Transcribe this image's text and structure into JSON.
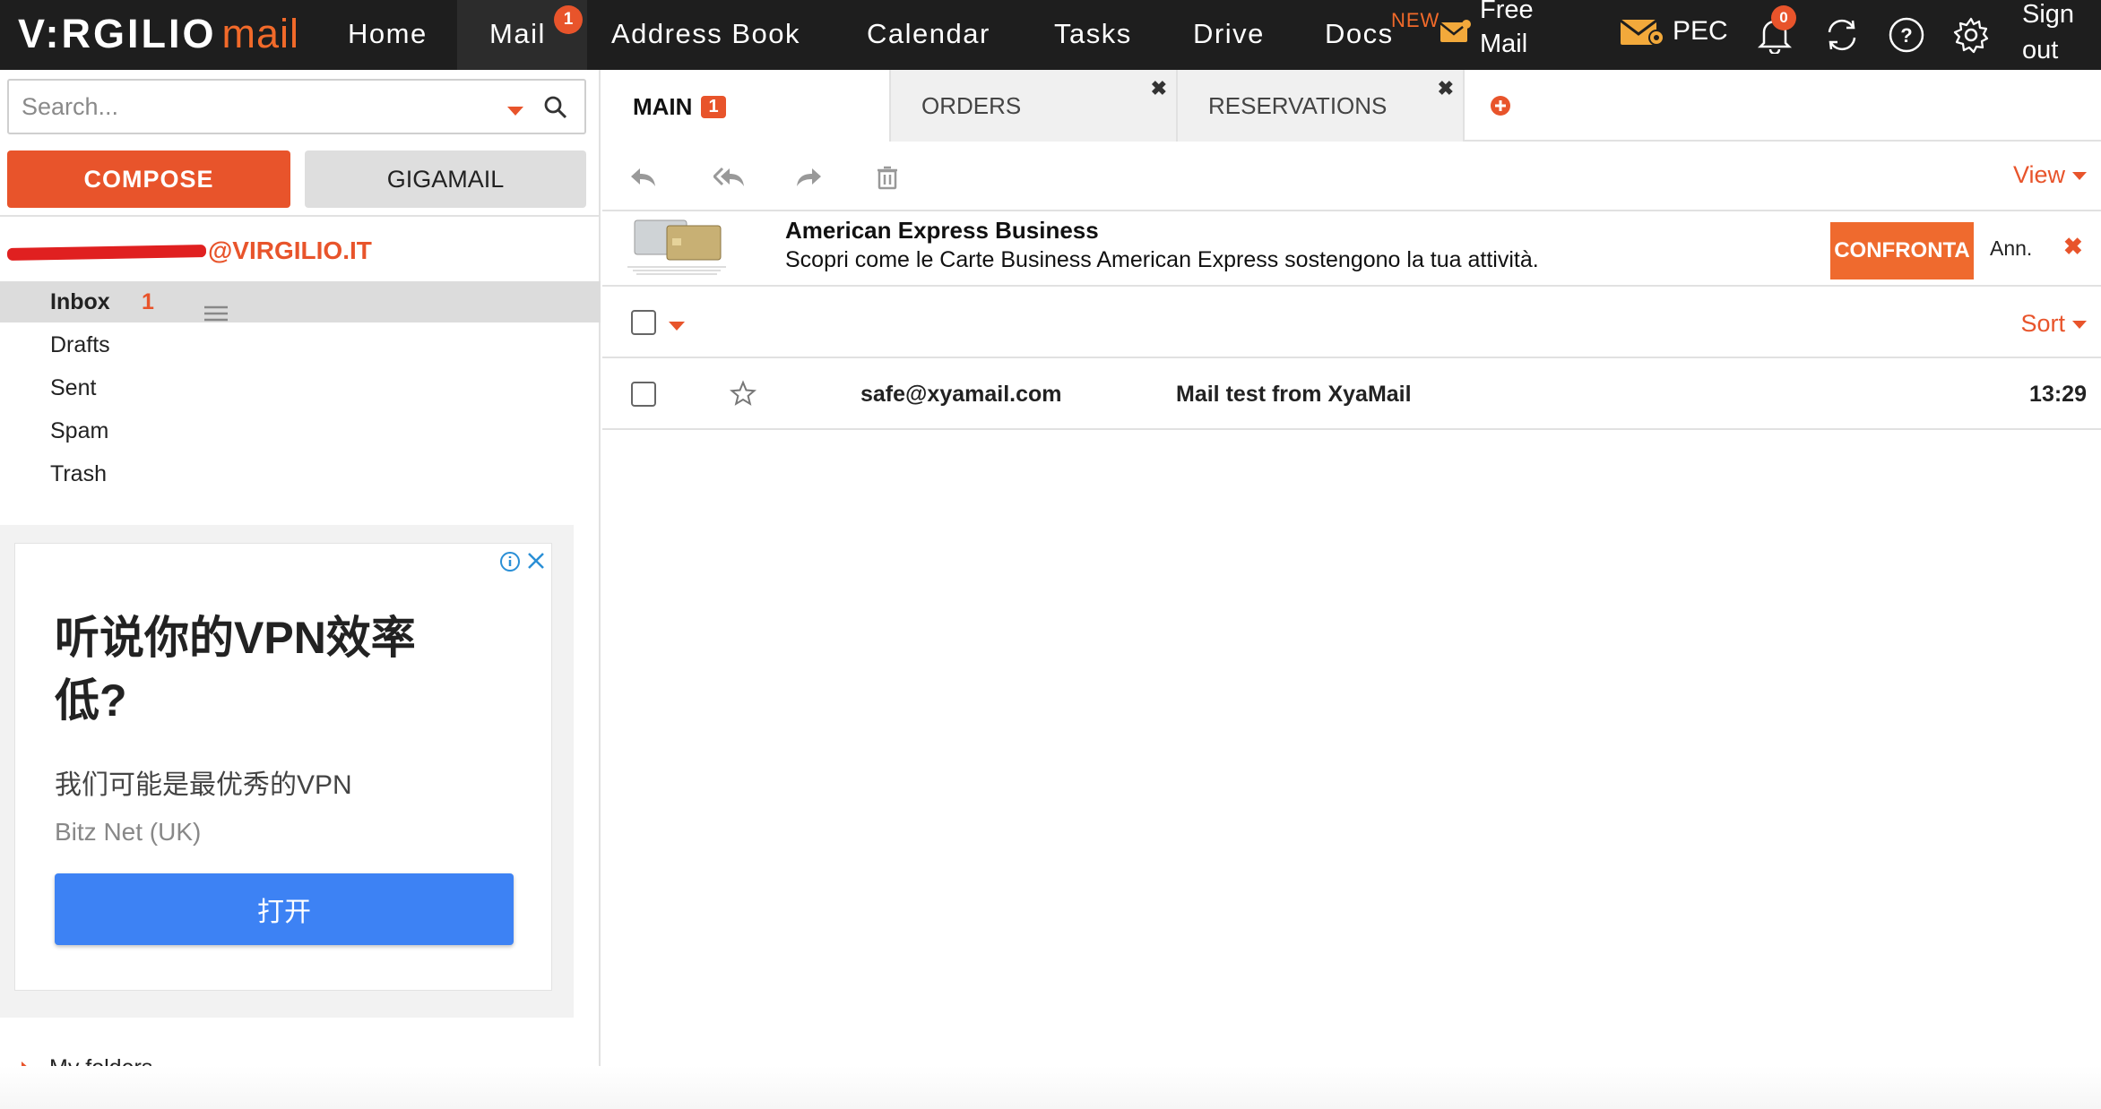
{
  "brand": {
    "logo_text": "V:RGILIO",
    "logo_mail": "mail"
  },
  "nav": {
    "items": [
      {
        "label": "Home"
      },
      {
        "label": "Mail",
        "badge": "1"
      },
      {
        "label": "Address Book"
      },
      {
        "label": "Calendar"
      },
      {
        "label": "Tasks"
      },
      {
        "label": "Drive"
      },
      {
        "label": "Docs",
        "tag": "NEW"
      }
    ],
    "free_mail_plus": "Free Mail Plus",
    "pec": "PEC",
    "notifications_count": "0",
    "sign_out": "Sign out"
  },
  "sidebar": {
    "search_placeholder": "Search...",
    "compose": "COMPOSE",
    "gigamail": "GIGAMAIL",
    "account_suffix": "@VIRGILIO.IT",
    "folders": [
      {
        "label": "Inbox",
        "count": "1"
      },
      {
        "label": "Drafts"
      },
      {
        "label": "Sent"
      },
      {
        "label": "Spam"
      },
      {
        "label": "Trash"
      }
    ],
    "my_folders": "My folders"
  },
  "side_ad": {
    "title": "听说你的VPN效率低?",
    "subtitle": "我们可能是最优秀的VPN",
    "advertiser": "Bitz Net (UK)",
    "open_button": "打开"
  },
  "tabs": [
    {
      "label": "MAIN",
      "badge": "1"
    },
    {
      "label": "ORDERS"
    },
    {
      "label": "RESERVATIONS"
    }
  ],
  "toolbar": {
    "view": "View"
  },
  "inline_ad": {
    "title": "American Express Business",
    "description": "Scopri come le Carte Business American Express sostengono la tua attività.",
    "cta": "CONFRONTA",
    "label": "Ann."
  },
  "list": {
    "sort": "Sort"
  },
  "messages": [
    {
      "from": "safe@xyamail.com",
      "subject": "Mail test from XyaMail",
      "time": "13:29"
    }
  ],
  "colors": {
    "accent": "#e8542b",
    "topbar": "#1e1e1e",
    "ad_button": "#3d82f4"
  }
}
